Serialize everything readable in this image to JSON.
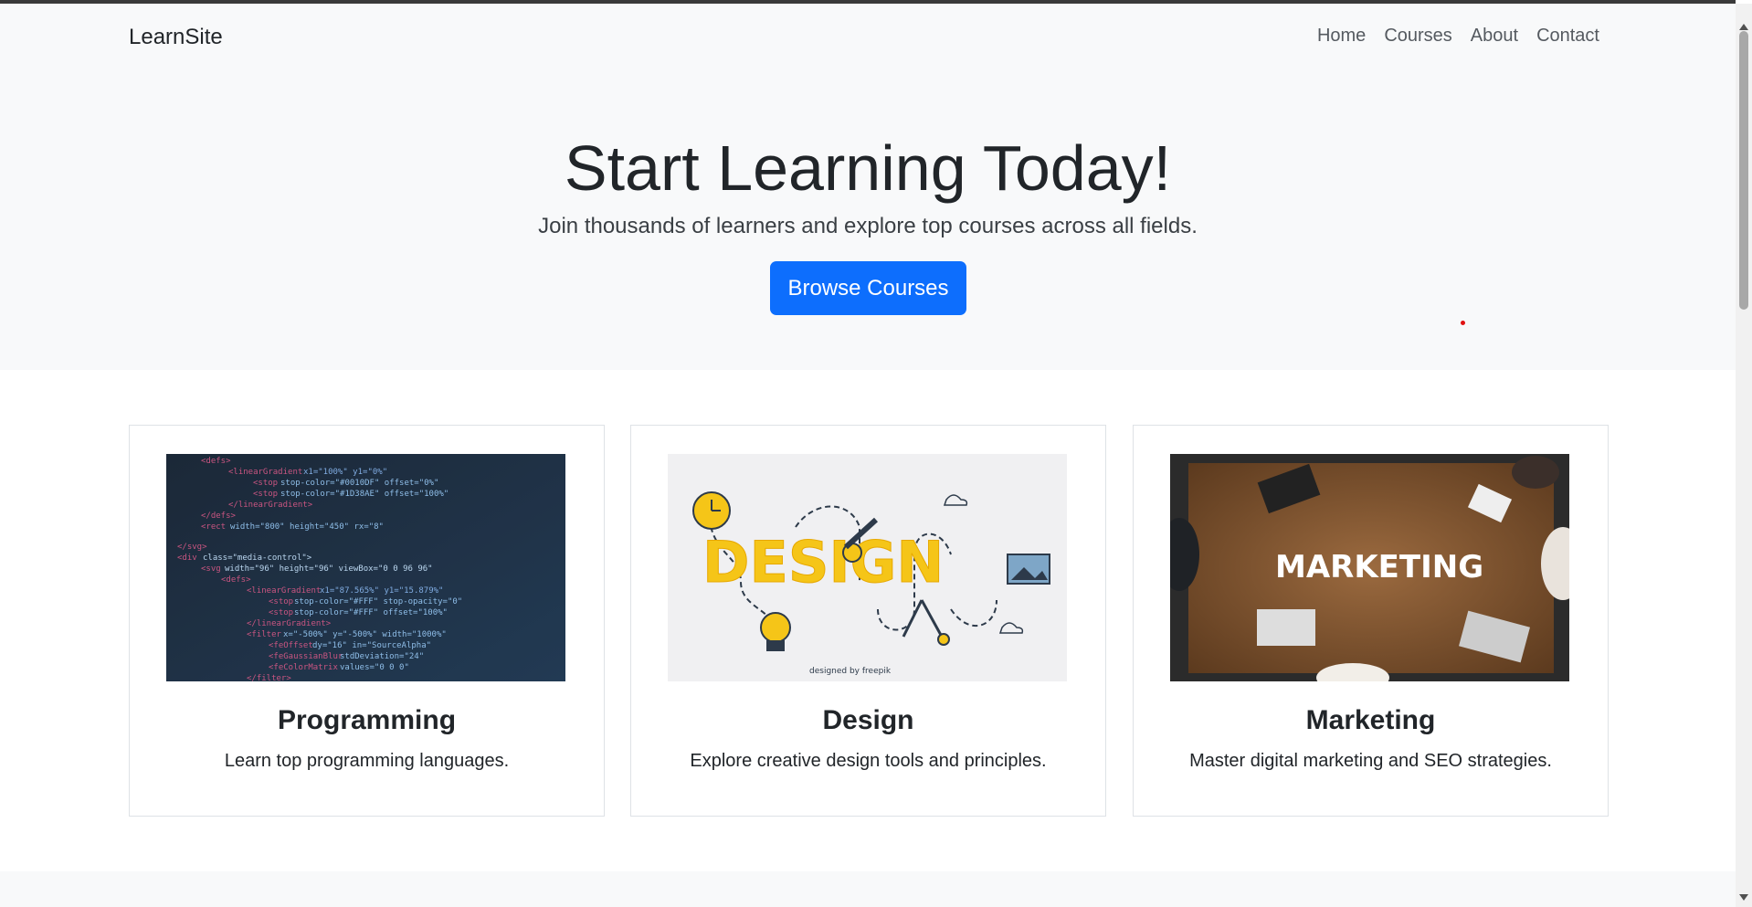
{
  "navbar": {
    "brand": "LearnSite",
    "links": [
      "Home",
      "Courses",
      "About",
      "Contact"
    ]
  },
  "hero": {
    "title": "Start Learning Today!",
    "subtitle": "Join thousands of learners and explore top courses across all fields.",
    "button": "Browse Courses"
  },
  "cards": [
    {
      "title": "Programming",
      "text": "Learn top programming languages.",
      "image": "code-screenshot-image"
    },
    {
      "title": "Design",
      "text": "Explore creative design tools and principles.",
      "image": "design-illustration-image",
      "image_text": "DESIGN",
      "image_credit": "designed by freepik"
    },
    {
      "title": "Marketing",
      "text": "Master digital marketing and SEO strategies.",
      "image": "marketing-wordcloud-image",
      "image_text": "MARKETING"
    }
  ],
  "colors": {
    "primary": "#0d6efd",
    "light_bg": "#f8f9fa",
    "text": "#212529"
  }
}
